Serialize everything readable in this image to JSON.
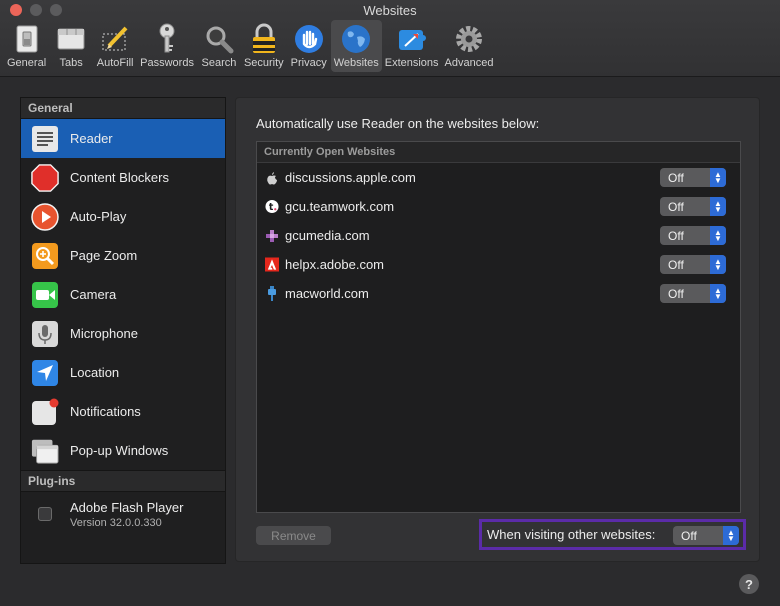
{
  "window": {
    "title": "Websites"
  },
  "toolbar": {
    "items": [
      {
        "label": "General",
        "icon": "general-switch-icon"
      },
      {
        "label": "Tabs",
        "icon": "tabs-icon"
      },
      {
        "label": "AutoFill",
        "icon": "autofill-pencil-icon"
      },
      {
        "label": "Passwords",
        "icon": "key-icon"
      },
      {
        "label": "Search",
        "icon": "magnifier-icon"
      },
      {
        "label": "Security",
        "icon": "padlock-icon"
      },
      {
        "label": "Privacy",
        "icon": "hand-icon"
      },
      {
        "label": "Websites",
        "icon": "globe-icon",
        "active": true
      },
      {
        "label": "Extensions",
        "icon": "puzzle-icon"
      },
      {
        "label": "Advanced",
        "icon": "gear-icon"
      }
    ]
  },
  "sidebar": {
    "general_header": "General",
    "items": [
      {
        "label": "Reader",
        "icon": "reader-icon",
        "selected": true
      },
      {
        "label": "Content Blockers",
        "icon": "stop-sign-icon"
      },
      {
        "label": "Auto-Play",
        "icon": "play-icon"
      },
      {
        "label": "Page Zoom",
        "icon": "zoom-icon"
      },
      {
        "label": "Camera",
        "icon": "camera-icon"
      },
      {
        "label": "Microphone",
        "icon": "microphone-icon"
      },
      {
        "label": "Location",
        "icon": "location-arrow-icon"
      },
      {
        "label": "Notifications",
        "icon": "notification-icon"
      },
      {
        "label": "Pop-up Windows",
        "icon": "popup-window-icon"
      }
    ],
    "plugins_header": "Plug-ins",
    "plugin": {
      "name": "Adobe Flash Player",
      "version": "Version 32.0.0.330",
      "checked": false
    }
  },
  "main": {
    "heading": "Automatically use Reader on the websites below:",
    "list_header": "Currently Open Websites",
    "rows": [
      {
        "site": "discussions.apple.com",
        "value": "Off",
        "favicon": "apple-favicon-icon"
      },
      {
        "site": "gcu.teamwork.com",
        "value": "Off",
        "favicon": "teamwork-favicon-icon"
      },
      {
        "site": "gcumedia.com",
        "value": "Off",
        "favicon": "gcumedia-favicon-icon"
      },
      {
        "site": "helpx.adobe.com",
        "value": "Off",
        "favicon": "adobe-favicon-icon"
      },
      {
        "site": "macworld.com",
        "value": "Off",
        "favicon": "macworld-favicon-icon"
      }
    ],
    "remove_label": "Remove",
    "other_label": "When visiting other websites:",
    "other_value": "Off"
  },
  "help": {
    "label": "?"
  },
  "colors": {
    "accent": "#1a5fb4",
    "highlight": "#5b2ba8",
    "popup_arrow": "#2d6bd6"
  }
}
